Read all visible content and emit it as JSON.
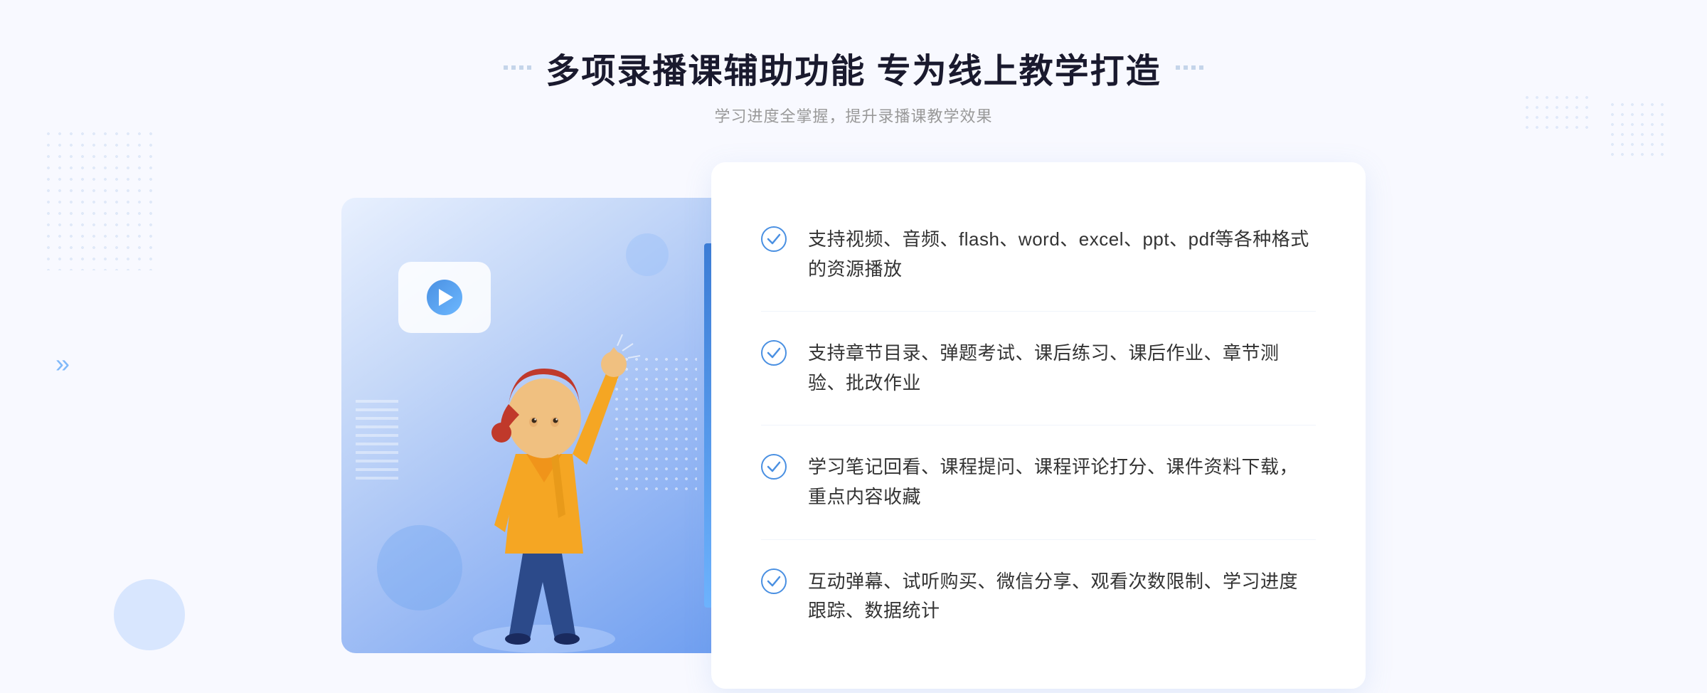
{
  "page": {
    "background_color": "#f5f8fe"
  },
  "header": {
    "title": "多项录播课辅助功能 专为线上教学打造",
    "subtitle": "学习进度全掌握，提升录播课教学效果",
    "title_decoration_left": "❖",
    "title_decoration_right": "❖"
  },
  "features": [
    {
      "id": 1,
      "text": "支持视频、音频、flash、word、excel、ppt、pdf等各种格式的资源播放"
    },
    {
      "id": 2,
      "text": "支持章节目录、弹题考试、课后练习、课后作业、章节测验、批改作业"
    },
    {
      "id": 3,
      "text": "学习笔记回看、课程提问、课程评论打分、课件资料下载，重点内容收藏"
    },
    {
      "id": 4,
      "text": "互动弹幕、试听购买、微信分享、观看次数限制、学习进度跟踪、数据统计"
    }
  ],
  "icons": {
    "check_circle": "✓",
    "play": "▶",
    "arrow_double": "»"
  },
  "colors": {
    "primary_blue": "#4a90e2",
    "light_blue": "#6db8ff",
    "text_dark": "#333333",
    "text_gray": "#999999",
    "accent": "#3a7bd5"
  }
}
